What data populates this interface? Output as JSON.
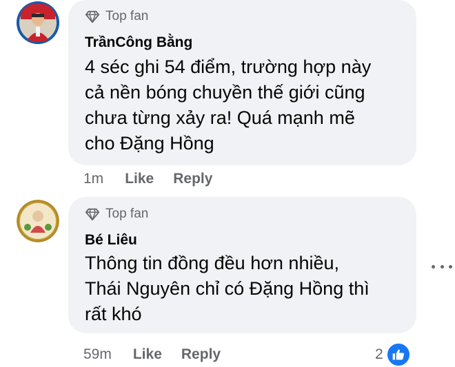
{
  "comments": [
    {
      "badge": "Top fan",
      "author": "TrầnCông Bằng",
      "lines": [
        "4 séc ghi 54 điểm, trường hợp này",
        "cả nền bóng chuyền thế giới cũng",
        "chưa từng xảy ra! Quá mạnh mẽ",
        "cho Đặng Hồng"
      ],
      "time": "1m",
      "like_label": "Like",
      "reply_label": "Reply"
    },
    {
      "badge": "Top fan",
      "author": "Bé Liêu",
      "lines": [
        "Thông tin đồng đều hơn nhiều,",
        "Thái Nguyên chỉ có Đặng Hồng thì",
        "rất khó"
      ],
      "time": "59m",
      "like_label": "Like",
      "reply_label": "Reply",
      "reaction_count": "2"
    }
  ],
  "colors": {
    "bubble_bg": "#f0f2f5",
    "secondary_text": "#65676b",
    "like_blue": "#1877f2"
  },
  "icons": {
    "badge": "diamond-icon",
    "reaction": "thumbs-up-icon",
    "more": "more-options-icon"
  }
}
